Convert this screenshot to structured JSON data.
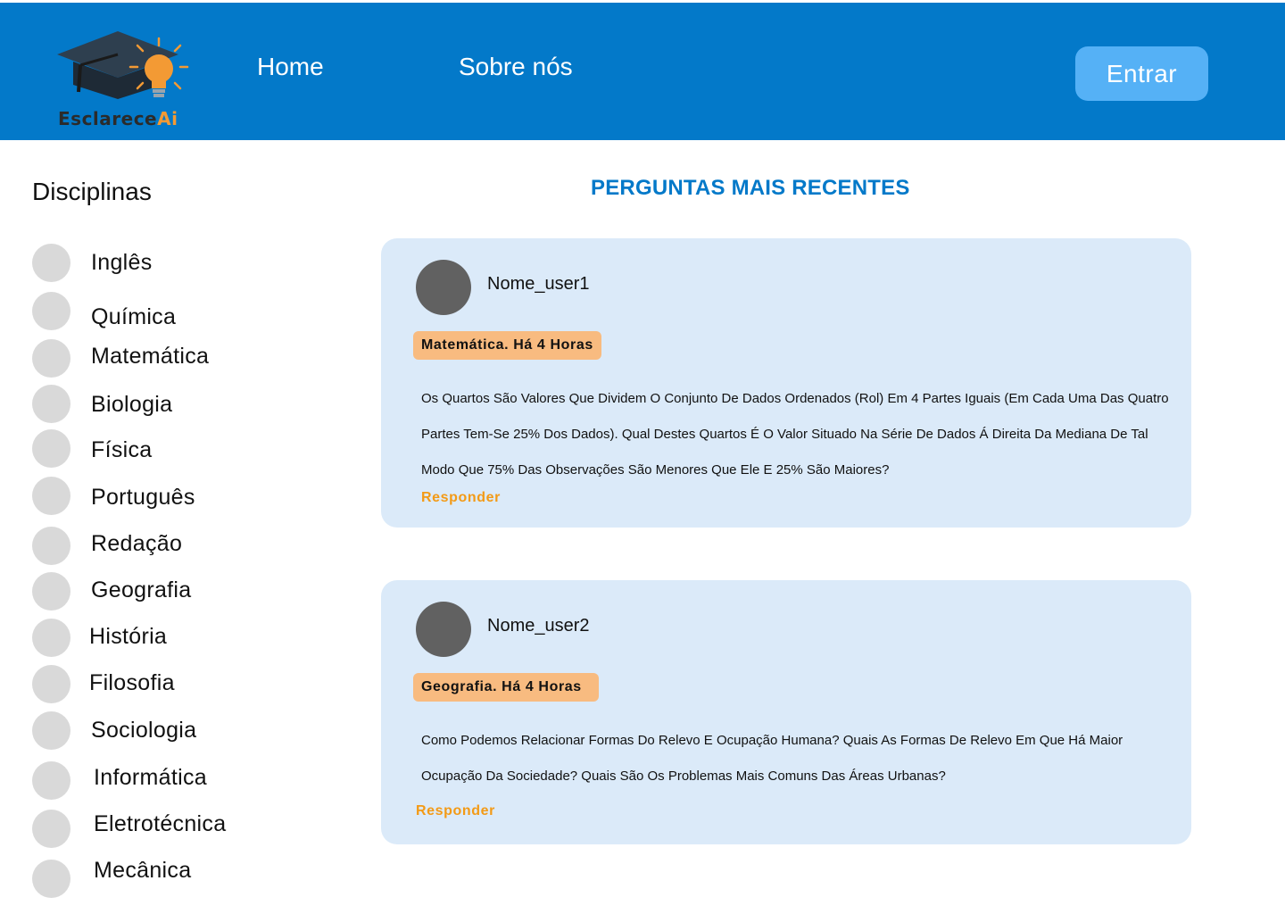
{
  "header": {
    "logo": {
      "text_main": "Esclarece",
      "text_accent": "Ai",
      "icon": "graduation-cap-lightbulb-icon"
    },
    "nav": [
      {
        "label": "Home"
      },
      {
        "label": "Sobre nós"
      }
    ],
    "login_label": "Entrar"
  },
  "sidebar": {
    "title": "Disciplinas",
    "subjects": [
      {
        "label": "Inglês"
      },
      {
        "label": "Química"
      },
      {
        "label": "Matemática"
      },
      {
        "label": "Biologia"
      },
      {
        "label": "Física"
      },
      {
        "label": "Português"
      },
      {
        "label": "Redação"
      },
      {
        "label": "Geografia"
      },
      {
        "label": "História"
      },
      {
        "label": "Filosofia"
      },
      {
        "label": "Sociologia"
      },
      {
        "label": "Informática"
      },
      {
        "label": "Eletrotécnica"
      },
      {
        "label": "Mecânica"
      }
    ]
  },
  "main": {
    "title": "PERGUNTAS MAIS RECENTES",
    "questions": [
      {
        "user": "Nome_user1",
        "tag": "Matemática. Há 4 Horas",
        "text": "Os Quartos São Valores Que Dividem O Conjunto De Dados Ordenados (Rol) Em 4 Partes Iguais (Em Cada Uma Das Quatro Partes Tem-Se 25% Dos Dados). Qual Destes Quartos É O Valor Situado Na Série De Dados Á Direita Da Mediana De Tal Modo Que 75% Das Observações São Menores Que Ele E 25% São Maiores?",
        "reply_label": "Responder"
      },
      {
        "user": "Nome_user2",
        "tag": "Geografia. Há 4 Horas",
        "text": "Como Podemos Relacionar Formas Do Relevo E Ocupação Humana? Quais As Formas De Relevo Em Que Há Maior Ocupação Da Sociedade? Quais São Os Problemas Mais Comuns Das Áreas Urbanas?",
        "reply_label": "Responder"
      }
    ]
  },
  "colors": {
    "header_bg": "#0379c9",
    "login_bg": "#55b1f6",
    "card_bg": "#dbeaf9",
    "tag_bg": "#f8bb80",
    "accent_orange": "#f39a16",
    "avatar_gray": "#616161",
    "subject_dot": "#d9d9d9"
  }
}
